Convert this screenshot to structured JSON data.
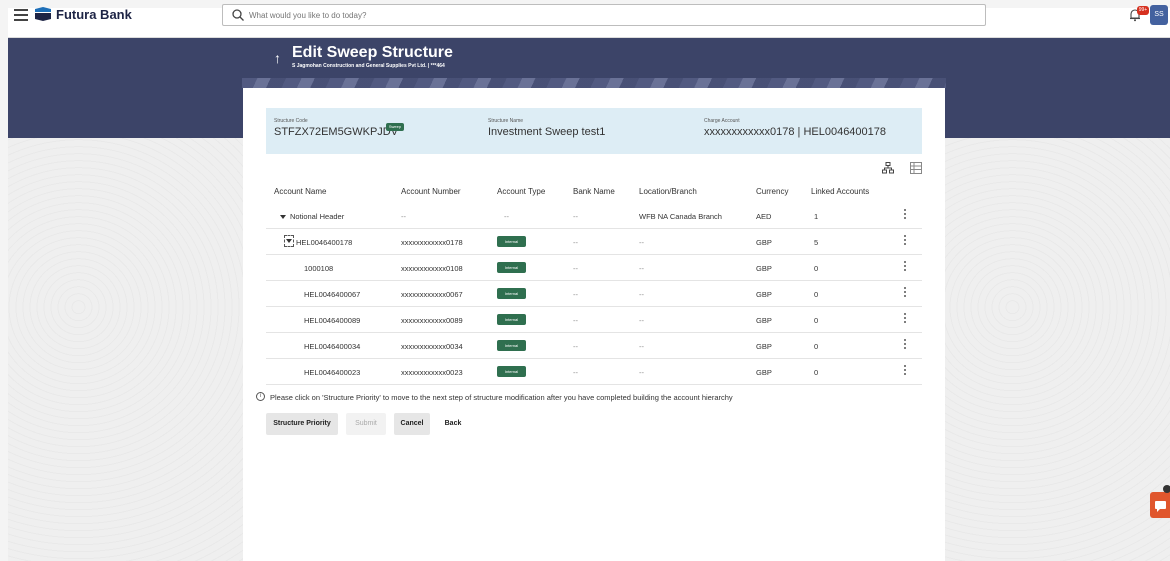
{
  "header": {
    "brand": "Futura Bank",
    "search_placeholder": "What would you like to do today?",
    "notification_badge": "99+",
    "avatar_initials": "SS"
  },
  "page": {
    "title": "Edit Sweep Structure",
    "subtitle": "S Jagmohan Construction and General Supplies Pvt Ltd. | ***464"
  },
  "summary": {
    "structure_code_label": "Structure Code",
    "structure_code": "STFZX72EM5GWKPJDV",
    "sweep_tag": "Sweep",
    "structure_name_label": "Structure Name",
    "structure_name": "Investment Sweep test1",
    "charge_account_label": "Charge Account",
    "charge_account": "xxxxxxxxxxxx0178 | HEL0046400178"
  },
  "table": {
    "headers": [
      "Account Name",
      "Account Number",
      "Account Type",
      "Bank Name",
      "Location/Branch",
      "Currency",
      "Linked Accounts"
    ],
    "rows": [
      {
        "name": "Notional Header",
        "number": "--",
        "type": "--",
        "bank": "--",
        "location": "WFB NA Canada Branch",
        "currency": "AED",
        "linked": "1"
      },
      {
        "name": "HEL0046400178",
        "number": "xxxxxxxxxxxx0178",
        "type": "Internal",
        "bank": "--",
        "location": "--",
        "currency": "GBP",
        "linked": "5"
      },
      {
        "name": "1000108",
        "number": "xxxxxxxxxxxx0108",
        "type": "Internal",
        "bank": "--",
        "location": "--",
        "currency": "GBP",
        "linked": "0"
      },
      {
        "name": "HEL0046400067",
        "number": "xxxxxxxxxxxx0067",
        "type": "Internal",
        "bank": "--",
        "location": "--",
        "currency": "GBP",
        "linked": "0"
      },
      {
        "name": "HEL0046400089",
        "number": "xxxxxxxxxxxx0089",
        "type": "Internal",
        "bank": "--",
        "location": "--",
        "currency": "GBP",
        "linked": "0"
      },
      {
        "name": "HEL0046400034",
        "number": "xxxxxxxxxxxx0034",
        "type": "Internal",
        "bank": "--",
        "location": "--",
        "currency": "GBP",
        "linked": "0"
      },
      {
        "name": "HEL0046400023",
        "number": "xxxxxxxxxxxx0023",
        "type": "Internal",
        "bank": "--",
        "location": "--",
        "currency": "GBP",
        "linked": "0"
      }
    ]
  },
  "note": "Please click on 'Structure Priority' to move to the next step of structure modification after you have completed building the account hierarchy",
  "buttons": {
    "structure_priority": "Structure Priority",
    "submit": "Submit",
    "cancel": "Cancel",
    "back": "Back"
  }
}
